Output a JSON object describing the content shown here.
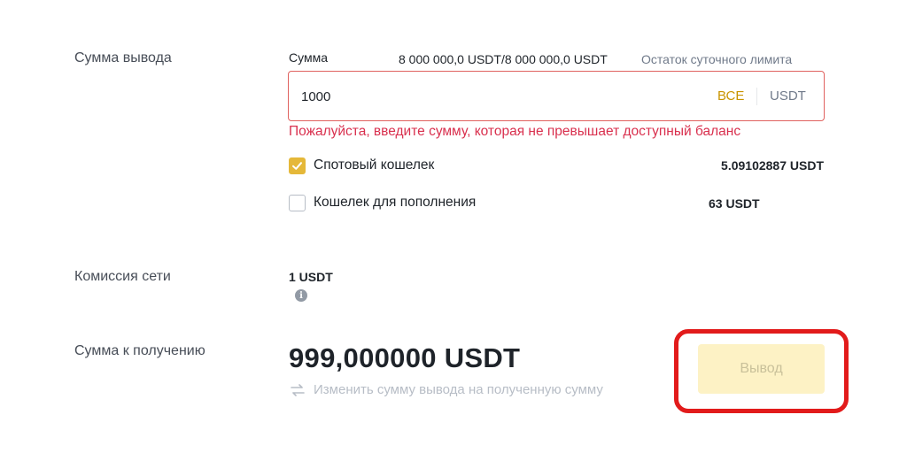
{
  "withdraw_amount": {
    "label": "Сумма вывода",
    "field_label": "Сумма",
    "limit_value": "8 000 000,0 USDT/8 000 000,0 USDT",
    "limit_label": "Остаток суточного лимита",
    "input_value": "1000",
    "all_label": "ВСЕ",
    "currency": "USDT",
    "error": "Пожалуйста, введите сумму, которая не превышает доступный баланс"
  },
  "wallets": [
    {
      "label": "Спотовый кошелек",
      "balance": "5.09102887 USDT",
      "checked": true
    },
    {
      "label": "Кошелек для пополнения",
      "balance": "63 USDT",
      "checked": false
    }
  ],
  "fee": {
    "label": "Комиссия сети",
    "value": "1 USDT",
    "info_icon": "info-icon"
  },
  "receive": {
    "label": "Сумма к получению",
    "amount": "999,000000 USDT",
    "switch_text": "Изменить сумму вывода на полученную сумму",
    "switch_icon": "swap-arrows-icon"
  },
  "withdraw_button": {
    "label": "Вывод"
  },
  "colors": {
    "accent": "#e5b839",
    "link_accent": "#c99400",
    "error": "#d9304e",
    "button_disabled_bg": "#fdf2c5",
    "highlight": "#e21b1b"
  }
}
